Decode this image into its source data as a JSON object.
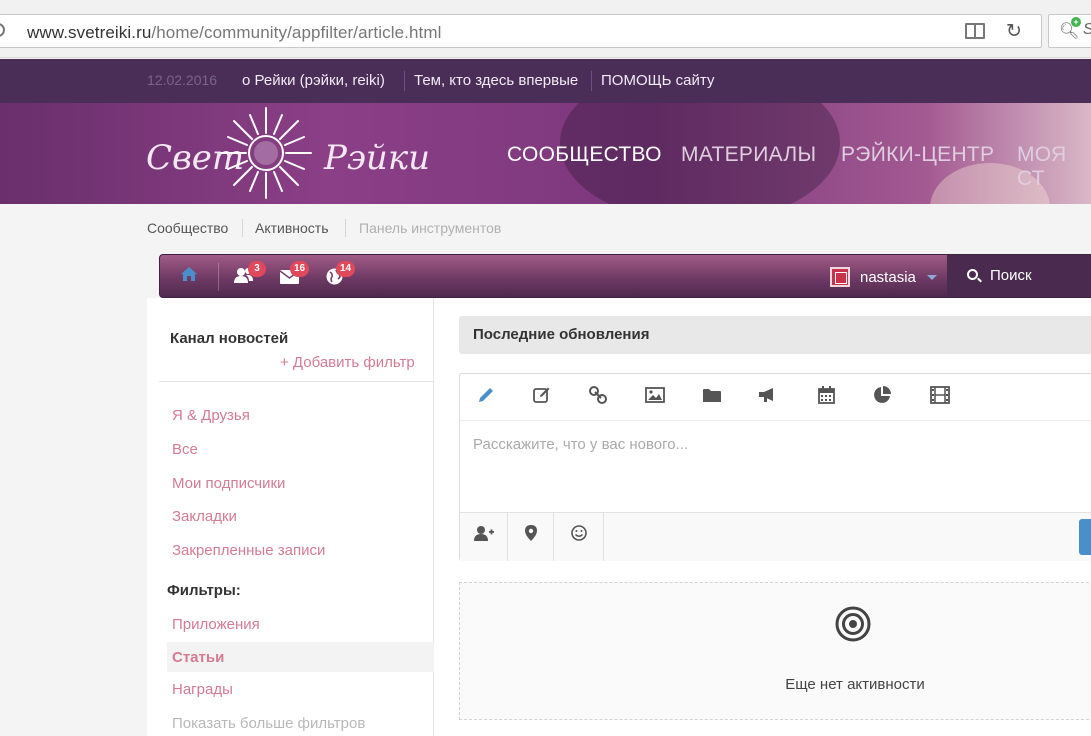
{
  "browser": {
    "url_domain": "www.svetreiki.ru",
    "url_path": "/home/community/appfilter/article.html",
    "ext_letter": "S"
  },
  "topnav": {
    "date": "12.02.2016",
    "links": [
      "о Рейки (рэйки, reiki)",
      "Тем, кто здесь впервые",
      "ПОМОЩЬ сайту"
    ]
  },
  "header": {
    "logo_left": "Свет",
    "logo_right": "Рэйки",
    "nav": [
      "СООБЩЕСТВО",
      "МАТЕРИАЛЫ",
      "РЭЙКИ-ЦЕНТР",
      "МОЯ СТ"
    ]
  },
  "breadcrumb": [
    "Сообщество",
    "Активность",
    "Панель инструментов"
  ],
  "toolbar": {
    "badges": {
      "friends": "3",
      "messages": "16",
      "notifications": "14"
    },
    "username": "nastasia",
    "search_label": "Поиск"
  },
  "sidebar": {
    "title": "Канал новостей",
    "add_filter": "+ Добавить фильтр",
    "items": [
      "Я & Друзья",
      "Все",
      "Мои подписчики",
      "Закладки",
      "Закрепленные записи"
    ],
    "filters_label": "Фильтры:",
    "filter_items": [
      "Приложения",
      "Статьи",
      "Награды"
    ],
    "more_filters": "Показать больше фильтров"
  },
  "main": {
    "updates_title": "Последние обновления",
    "composer_placeholder": "Расскажите, что у вас нового...",
    "empty_text": "Еще нет активности"
  },
  "colors": {
    "topnav_bg": "#4a2e58",
    "link_pink": "#d37c93",
    "badge_red": "#e0485c",
    "accent_blue": "#4a8fc9"
  }
}
